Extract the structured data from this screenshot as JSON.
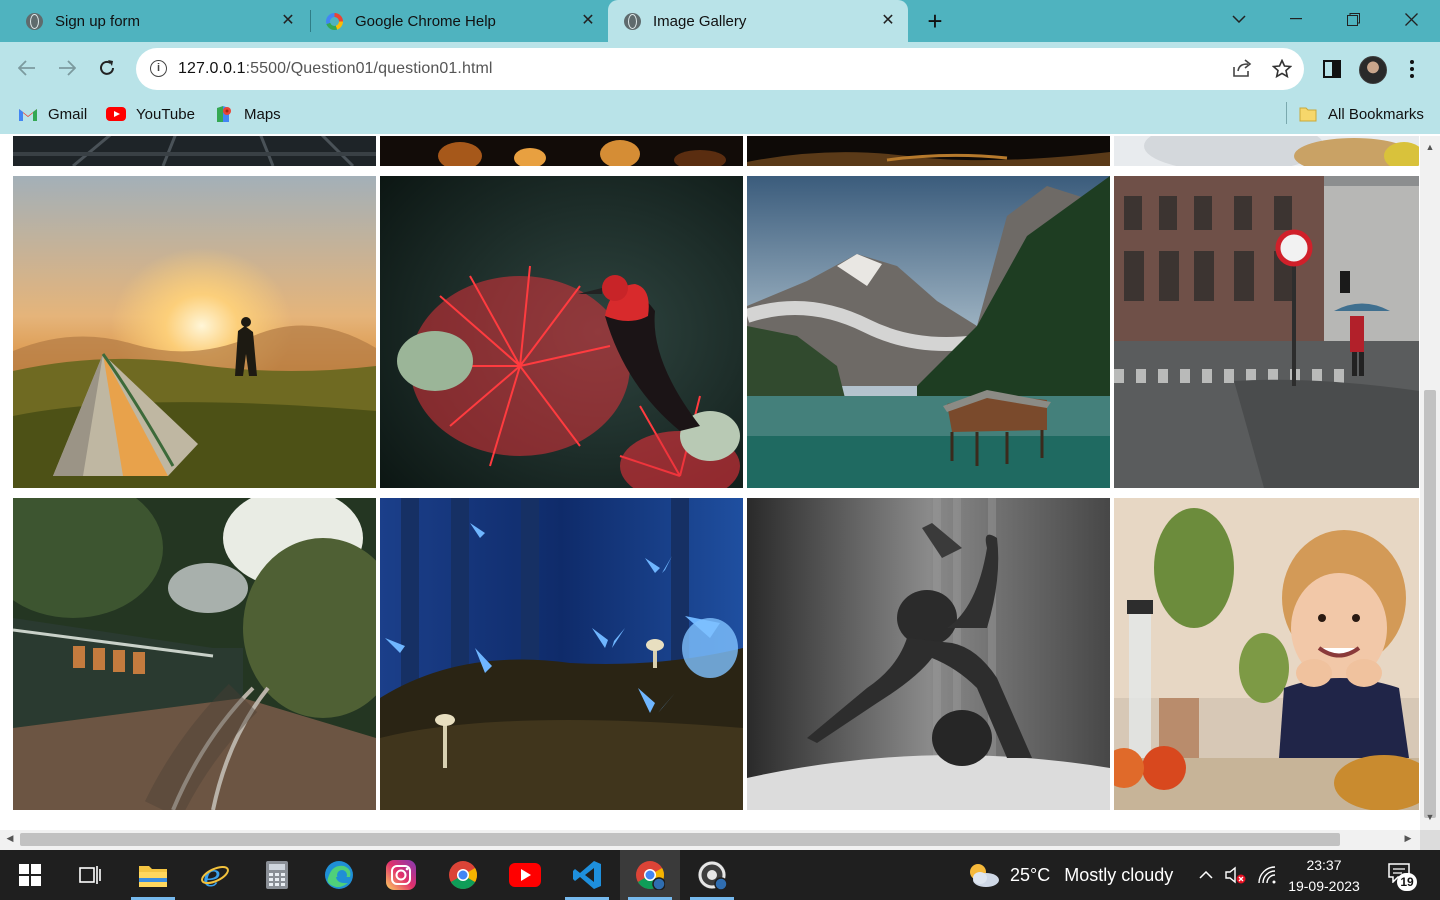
{
  "browser": {
    "tabs": [
      {
        "title": "Sign up form",
        "favicon": "globe-icon",
        "active": false
      },
      {
        "title": "Google Chrome Help",
        "favicon": "google-icon",
        "active": false
      },
      {
        "title": "Image Gallery",
        "favicon": "globe-icon",
        "active": true
      }
    ],
    "close_glyph": "✕",
    "new_tab_glyph": "+",
    "address": {
      "host": "127.0.0.1",
      "path": ":5500/Question01/question01.html"
    },
    "bookmarks": [
      {
        "label": "Gmail",
        "icon": "gmail-icon"
      },
      {
        "label": "YouTube",
        "icon": "youtube-icon"
      },
      {
        "label": "Maps",
        "icon": "maps-icon"
      }
    ],
    "all_bookmarks": "All Bookmarks"
  },
  "gallery": {
    "images": [
      {
        "subject": "railway-tracks"
      },
      {
        "subject": "candles"
      },
      {
        "subject": "night-landscape"
      },
      {
        "subject": "fruit"
      },
      {
        "subject": "camping-tent-sunrise"
      },
      {
        "subject": "red-bird-on-flower"
      },
      {
        "subject": "mountain-lake-cabin"
      },
      {
        "subject": "rainy-city-street"
      },
      {
        "subject": "steam-train-forest"
      },
      {
        "subject": "blue-butterflies"
      },
      {
        "subject": "dancer-shadow"
      },
      {
        "subject": "smiling-child"
      }
    ]
  },
  "taskbar": {
    "apps": [
      "windows-start-icon",
      "task-view-icon",
      "file-explorer-icon",
      "internet-explorer-icon",
      "calculator-icon",
      "edge-icon",
      "instagram-icon",
      "chrome-icon",
      "youtube-icon",
      "vscode-icon",
      "chrome-icon",
      "chrome-dev-icon"
    ],
    "weather": {
      "temp": "25°C",
      "condition": "Mostly cloudy"
    },
    "time": "23:37",
    "date": "19-09-2023",
    "notifications": "19"
  }
}
